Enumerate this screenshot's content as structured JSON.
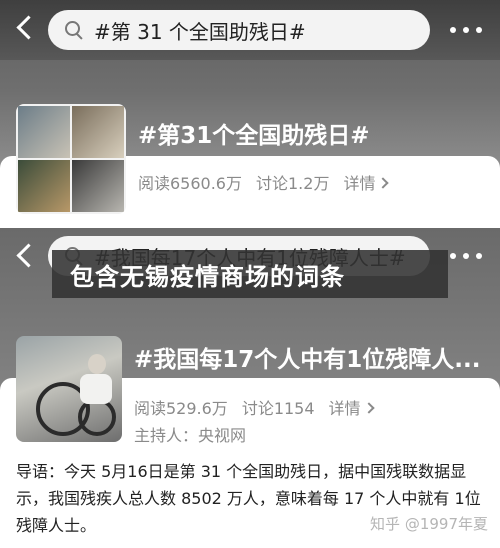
{
  "panel1": {
    "search_query": "#第 31 个全国助残日#",
    "topic_title": "#第31个全国助残日#",
    "reads": "阅读6560.6万",
    "discussions": "讨论1.2万",
    "details": "详情"
  },
  "panel2": {
    "search_query": "#我国每17个人中有1位残障人士#",
    "topic_title": "#我国每17个人中有1位残障人...",
    "reads": "阅读529.6万",
    "discussions": "讨论1154",
    "details": "详情",
    "host": "主持人：央视网",
    "guide_text": "导语：今天 5月16日是第 31 个全国助残日，据中国残联数据显示，我国残疾人总人数 8502 万人，意味着每 17 个人中就有 1位残障人士。"
  },
  "overlay_title": "包含无锡疫情商场的词条",
  "watermark": "知乎 @1997年夏",
  "colors": {
    "overlay_bg": "#323232",
    "stat_text": "#8a8a8a"
  }
}
